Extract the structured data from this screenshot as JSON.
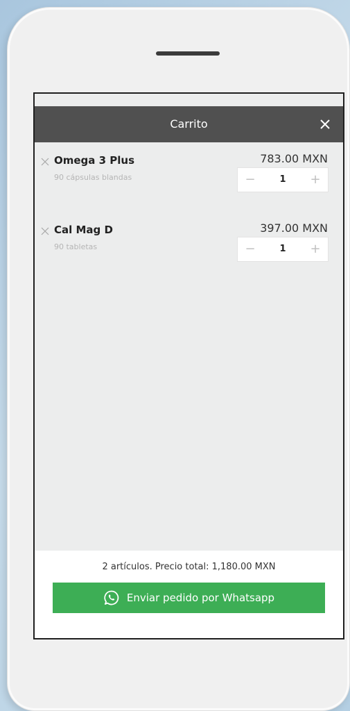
{
  "cart": {
    "title": "Carrito",
    "close_icon": "close-icon",
    "items": [
      {
        "name": "Omega 3 Plus",
        "description": "90 cápsulas blandas",
        "price": "783.00 MXN",
        "quantity": "1",
        "minus": "−",
        "plus": "+"
      },
      {
        "name": "Cal Mag D",
        "description": "90 tabletas",
        "price": "397.00 MXN",
        "quantity": "1",
        "minus": "−",
        "plus": "+"
      }
    ],
    "summary": "2 artículos. Precio total: 1,180.00 MXN",
    "send_button": "Enviar pedido por Whatsapp",
    "send_icon": "whatsapp-icon"
  },
  "colors": {
    "header_bg": "#505050",
    "button_bg": "#3dae55",
    "screen_bg": "#eceded"
  }
}
